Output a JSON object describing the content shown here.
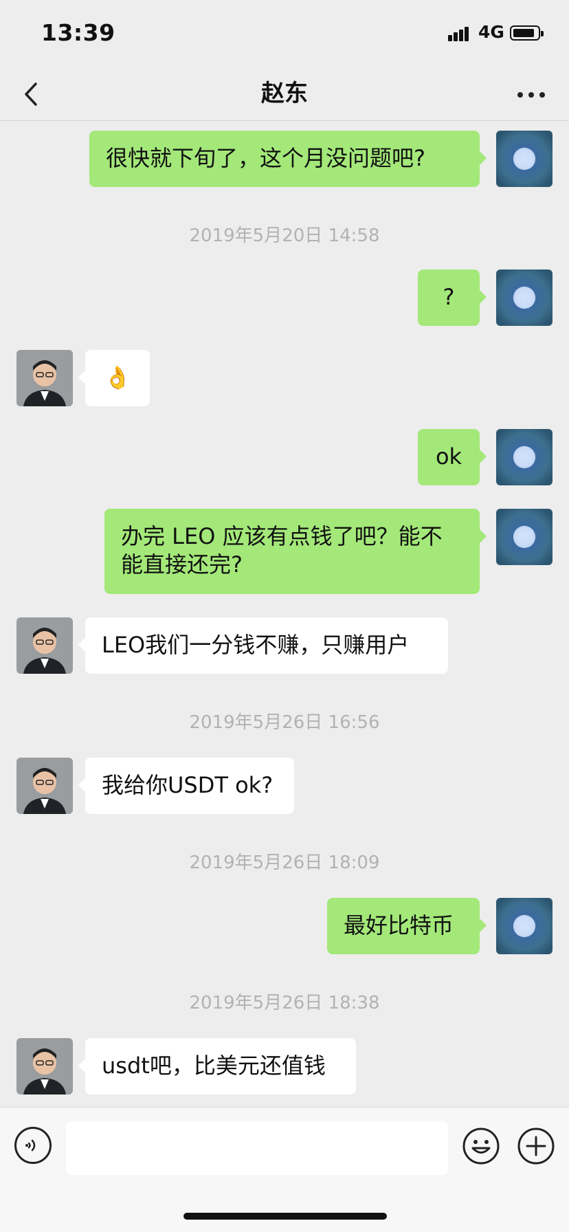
{
  "status_bar": {
    "time": "13:39",
    "network": "4G"
  },
  "header": {
    "title": "赵东"
  },
  "messages": [
    {
      "sender": "me",
      "text": "很快就下旬了，这个月没问题吧?"
    },
    {
      "timestamp": "2019年5月20日 14:58"
    },
    {
      "sender": "me",
      "text": "?"
    },
    {
      "sender": "other",
      "text": "👌"
    },
    {
      "sender": "me",
      "text": "ok"
    },
    {
      "sender": "me",
      "text": "办完 LEO 应该有点钱了吧？能不能直接还完?"
    },
    {
      "sender": "other",
      "text": "LEO我们一分钱不赚，只赚用户"
    },
    {
      "timestamp": "2019年5月26日 16:56"
    },
    {
      "sender": "other",
      "text": "我给你USDT ok?"
    },
    {
      "timestamp": "2019年5月26日 18:09"
    },
    {
      "sender": "me",
      "text": "最好比特币"
    },
    {
      "timestamp": "2019年5月26日 18:38"
    },
    {
      "sender": "other",
      "text": "usdt吧，比美元还值钱"
    }
  ],
  "input_bar": {
    "voice_icon": "voice-icon",
    "emoji_icon": "emoji-icon",
    "plus_icon": "plus-icon",
    "value": ""
  },
  "colors": {
    "background": "#ededed",
    "bubble_me": "#a3e879",
    "bubble_other": "#ffffff",
    "timestamp": "#b2b2b2"
  }
}
